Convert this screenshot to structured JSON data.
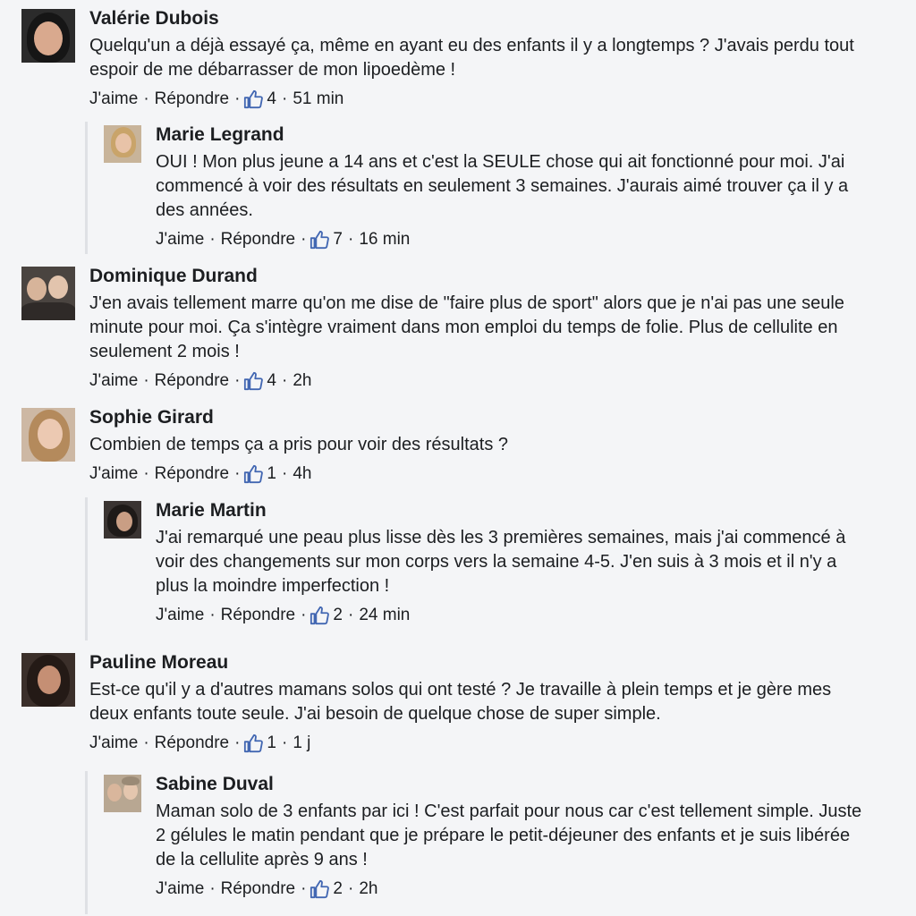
{
  "comments": [
    {
      "name": "Valérie Dubois",
      "text": "Quelqu'un a déjà essayé ça, même en ayant eu des enfants il y a longtemps ? J'avais perdu tout espoir de me débarrasser de mon lipoedème !",
      "like_label": "J'aime",
      "reply_label": "Répondre",
      "count": "4",
      "time": "51 min"
    },
    {
      "name": "Marie Legrand",
      "text": "OUI ! Mon plus jeune a 14 ans et c'est la SEULE chose qui ait fonctionné pour moi. J'ai commencé à voir des résultats en seulement 3 semaines. J'aurais aimé trouver ça il y a des années.",
      "like_label": "J'aime",
      "reply_label": "Répondre",
      "count": "7",
      "time": "16 min"
    },
    {
      "name": "Dominique Durand",
      "text": "J'en avais tellement marre qu'on me dise de \"faire plus de sport\" alors que je n'ai pas une seule minute pour moi. Ça s'intègre vraiment dans mon emploi du temps de folie. Plus de cellulite en seulement 2 mois !",
      "like_label": "J'aime",
      "reply_label": "Répondre",
      "count": "4",
      "time": "2h"
    },
    {
      "name": "Sophie Girard",
      "text": "Combien de temps ça a pris pour voir des résultats ?",
      "like_label": "J'aime",
      "reply_label": "Répondre",
      "count": "1",
      "time": "4h"
    },
    {
      "name": "Marie Martin",
      "text": "J'ai remarqué une peau plus lisse dès les 3 premières  semaines, mais j'ai commencé à voir des changements sur mon corps vers la semaine 4-5. J'en suis à 3 mois et il n'y a plus la moindre imperfection !",
      "like_label": "J'aime",
      "reply_label": "Répondre",
      "count": "2",
      "time": "24 min"
    },
    {
      "name": "Pauline Moreau",
      "text": "Est-ce qu'il y a d'autres mamans solos qui ont testé ? Je travaille à plein temps et je gère mes deux enfants toute seule. J'ai besoin de quelque chose de super simple.",
      "like_label": "J'aime",
      "reply_label": "Répondre",
      "count": "1",
      "time": "1 j"
    },
    {
      "name": "Sabine Duval",
      "text": "Maman solo de 3 enfants par ici ! C'est parfait pour nous car c'est tellement simple. Juste 2 gélules le matin pendant que je prépare le petit-déjeuner des enfants et je suis libérée de la cellulite après 9 ans !",
      "like_label": "J'aime",
      "reply_label": "Répondre",
      "count": "2",
      "time": "2h"
    }
  ],
  "colors": {
    "like_blue": "#4267b2",
    "text": "#1c1e21",
    "thread_line": "#dfe1e5"
  }
}
